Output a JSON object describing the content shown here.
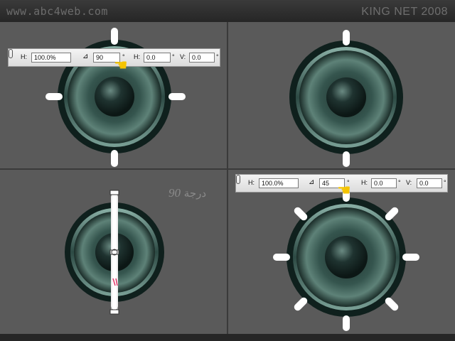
{
  "header": {
    "site_url": "www.abc4web.com",
    "brand": "KING NET 2008"
  },
  "toolbar_top": {
    "h_label": "H:",
    "scale": "100.0%",
    "angle_value": "90",
    "degree": "°",
    "h_skew_label": "H:",
    "h_skew": "0.0",
    "v_skew_label": "V:",
    "v_skew": "0.0"
  },
  "toolbar_bottom": {
    "h_label": "H:",
    "scale": "100.0%",
    "angle_value": "45",
    "degree": "°",
    "h_skew_label": "H:",
    "h_skew": "0.0",
    "v_skew_label": "V:",
    "v_skew": "0.0"
  },
  "caption": {
    "number": "90",
    "word": "درجة"
  },
  "icons": {
    "angle": "rotate-angle-icon",
    "link": "link-chain-icon",
    "pointer": "pointing-hand-icon"
  },
  "colors": {
    "panel": "#5a5a5a",
    "speaker_rim": "#0f201d",
    "speaker_cone": "#3d5e56",
    "tick": "#ffffff",
    "hand": "#f5c400"
  }
}
